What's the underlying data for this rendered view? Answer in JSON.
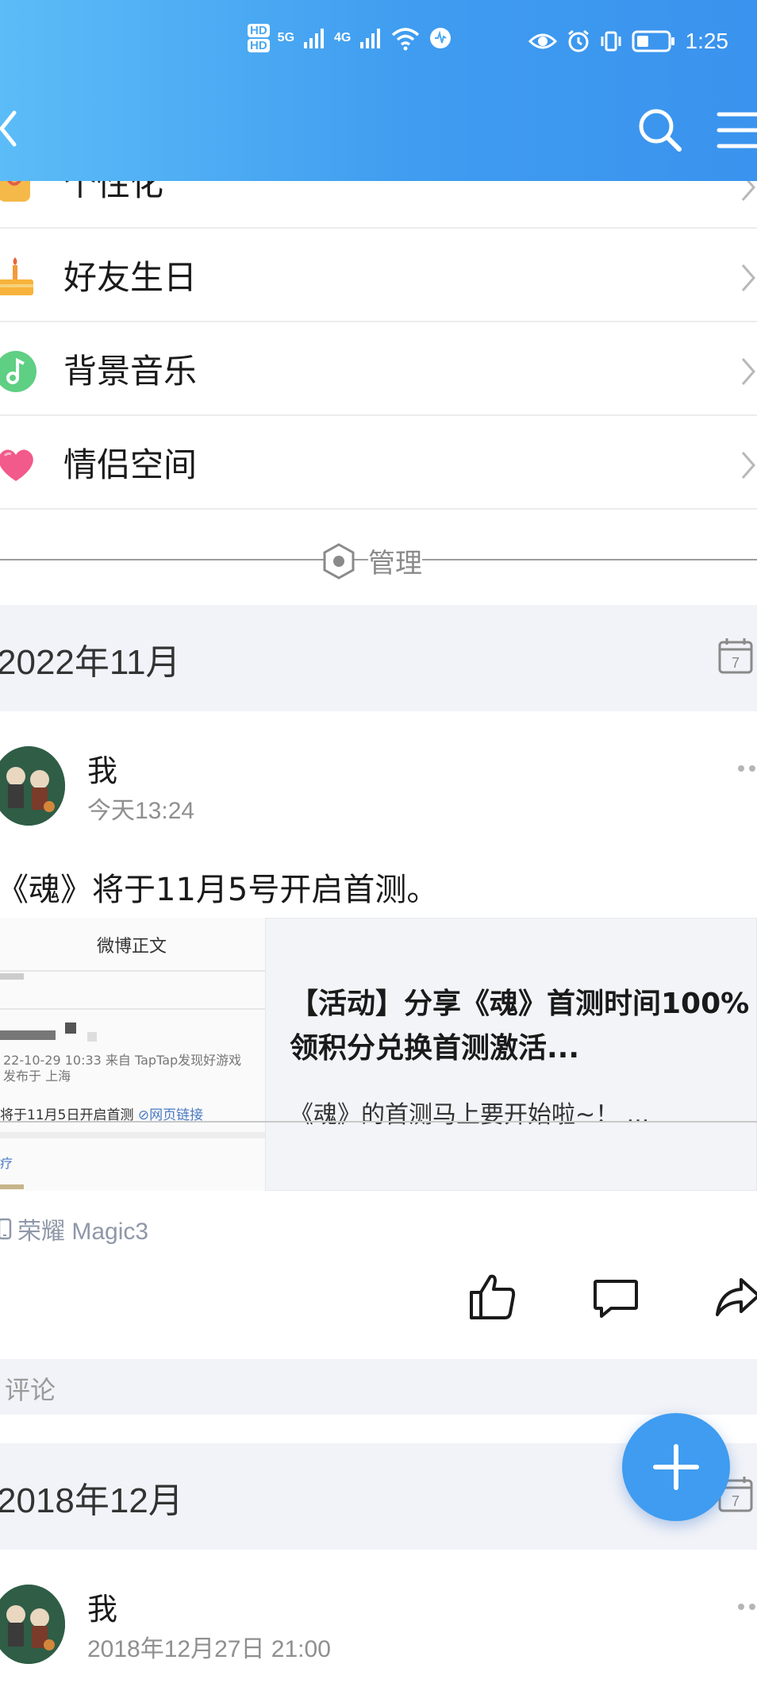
{
  "status_bar": {
    "time": "1:25",
    "net_hd1": "HD",
    "net_hd2": "HD",
    "net_5g": "5G",
    "net_4g": "4G"
  },
  "nav": {
    "back_icon": "chevron-left-icon",
    "search_icon": "search-icon",
    "menu_icon": "menu-icon"
  },
  "settings": {
    "items": [
      {
        "label": "个性化",
        "icon": "personalize-icon",
        "color": "#f5b94a"
      },
      {
        "label": "好友生日",
        "icon": "birthday-cake-icon",
        "color": "#f7b33b"
      },
      {
        "label": "背景音乐",
        "icon": "music-note-icon",
        "color": "#5fcf83"
      },
      {
        "label": "情侣空间",
        "icon": "heart-icon",
        "color": "#f25a8b"
      }
    ],
    "manage_label": "管理"
  },
  "sections": [
    {
      "title": "2022年11月",
      "post": {
        "author": "我",
        "time": "今天13:24",
        "text": "《魂》将于11月5号开启首测。",
        "share_card": {
          "thumb_title": "微博正文",
          "thumb_meta": "22-10-29 10:33  来自 TapTap发现好游戏",
          "thumb_location": "发布于 上海",
          "thumb_text": "将于11月5日开启首测",
          "thumb_link": "网页链接",
          "thumb_misc": "疗",
          "title": "【活动】分享《魂》首测时间100%领积分兑换首测激活...",
          "desc": "《魂》的首测马上要开始啦~！ ..."
        },
        "device": "荣耀 Magic3",
        "comment_placeholder": "评论"
      }
    },
    {
      "title": "2018年12月",
      "post": {
        "author": "我",
        "time": "2018年12月27日 21:00"
      }
    }
  ],
  "fab": {
    "icon": "plus-icon"
  },
  "colors": {
    "header_start": "#5bbcf7",
    "header_end": "#3a93ee",
    "fab": "#3f9cf0",
    "section_bg": "#f2f3f8"
  }
}
